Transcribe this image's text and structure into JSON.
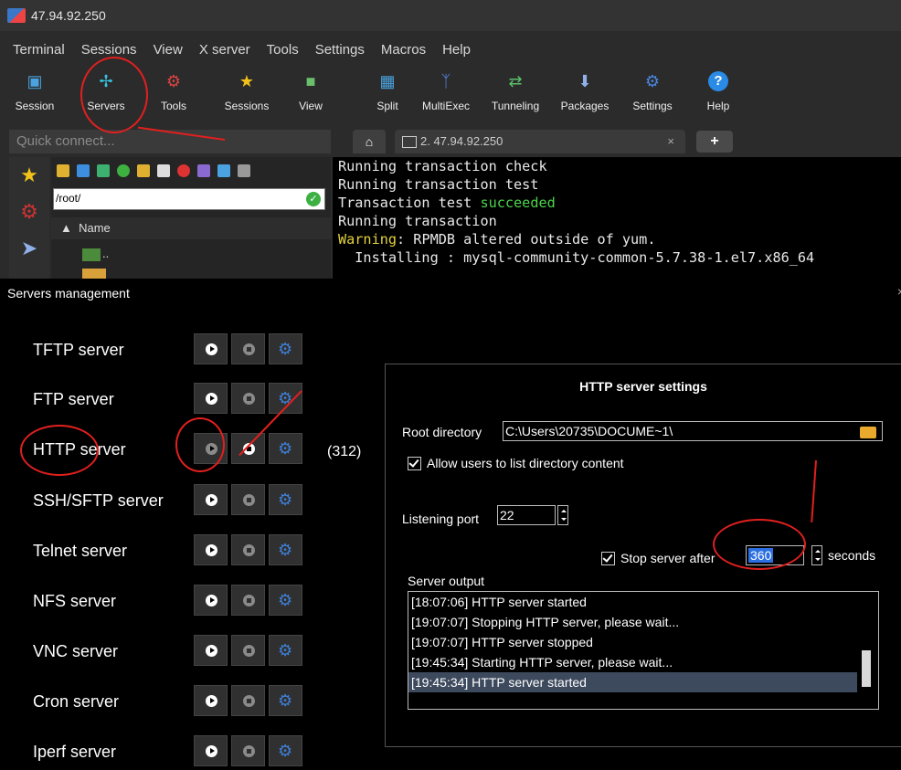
{
  "window": {
    "title": "47.94.92.250"
  },
  "menu": [
    "Terminal",
    "Sessions",
    "View",
    "X server",
    "Tools",
    "Settings",
    "Macros",
    "Help"
  ],
  "toolbar": [
    {
      "label": "Session",
      "icon": "session-icon"
    },
    {
      "label": "Servers",
      "icon": "servers-icon"
    },
    {
      "label": "Tools",
      "icon": "tools-icon"
    },
    {
      "label": "Sessions",
      "icon": "star-icon"
    },
    {
      "label": "View",
      "icon": "view-icon"
    },
    {
      "label": "Split",
      "icon": "split-icon"
    },
    {
      "label": "MultiExec",
      "icon": "multiexec-icon"
    },
    {
      "label": "Tunneling",
      "icon": "tunneling-icon"
    },
    {
      "label": "Packages",
      "icon": "packages-icon"
    },
    {
      "label": "Settings",
      "icon": "settings-icon"
    },
    {
      "label": "Help",
      "icon": "help-icon"
    }
  ],
  "quick_connect": {
    "placeholder": "Quick connect..."
  },
  "tabs": {
    "session_label": "2. 47.94.92.250",
    "close": "×",
    "add": "+"
  },
  "file_browser": {
    "path": "/root/",
    "name_header": "Name",
    "parent_entry": ".."
  },
  "terminal": {
    "lines": [
      {
        "parts": [
          {
            "text": "Running transaction check",
            "color": "default"
          }
        ]
      },
      {
        "parts": [
          {
            "text": "Running transaction test",
            "color": "default"
          }
        ]
      },
      {
        "parts": [
          {
            "text": "Transaction test ",
            "color": "default"
          },
          {
            "text": "succeeded",
            "color": "green"
          }
        ]
      },
      {
        "parts": [
          {
            "text": "Running transaction",
            "color": "default"
          }
        ]
      },
      {
        "parts": [
          {
            "text": "Warning",
            "color": "yellow"
          },
          {
            "text": ": RPMDB altered outside of yum.",
            "color": "default"
          }
        ]
      },
      {
        "parts": [
          {
            "text": "  Installing : mysql-community-common-5.7.38-1.el7.x86_64",
            "color": "default"
          }
        ]
      }
    ]
  },
  "servers_dialog": {
    "title": "Servers management",
    "close": "×",
    "servers": [
      {
        "name": "TFTP server",
        "running": false
      },
      {
        "name": "FTP server",
        "running": false
      },
      {
        "name": "HTTP server",
        "running": true,
        "pid": "(312)"
      },
      {
        "name": "SSH/SFTP server",
        "running": false
      },
      {
        "name": "Telnet server",
        "running": false
      },
      {
        "name": "NFS server",
        "running": false
      },
      {
        "name": "VNC server",
        "running": false
      },
      {
        "name": "Cron server",
        "running": false
      },
      {
        "name": "Iperf server",
        "running": false
      }
    ],
    "http_settings": {
      "header": "HTTP server settings",
      "root_dir_label": "Root directory",
      "root_dir_value": "C:\\Users\\20735\\DOCUME~1\\",
      "allow_list_label": "Allow users to list directory content",
      "allow_list_checked": true,
      "port_label": "Listening port",
      "port_value": "22",
      "stop_after_label": "Stop server after",
      "stop_after_checked": true,
      "stop_after_value": "360",
      "seconds_label": "seconds",
      "output_label": "Server output",
      "output_lines": [
        "[18:07:06] HTTP server started",
        "[19:07:07] Stopping HTTP server, please wait...",
        "[19:07:07] HTTP server stopped",
        "[19:45:34] Starting HTTP server, please wait...",
        "[19:45:34] HTTP server started"
      ],
      "selected_output_line": 4
    }
  },
  "colors": {
    "annotation_red": "#e0201f",
    "accent_blue": "#3e7fd6",
    "selection": "#3d4a5e"
  }
}
